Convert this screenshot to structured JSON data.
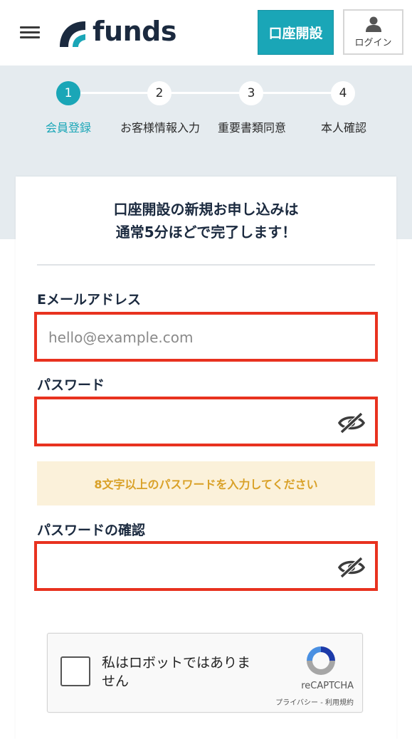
{
  "header": {
    "logo_text": "funds",
    "open_account_label": "口座開設",
    "login_label": "ログイン"
  },
  "steps": [
    {
      "number": "1",
      "label": "会員登録",
      "active": true
    },
    {
      "number": "2",
      "label": "お客様情報入力",
      "active": false
    },
    {
      "number": "3",
      "label": "重要書類同意",
      "active": false
    },
    {
      "number": "4",
      "label": "本人確認",
      "active": false
    }
  ],
  "form": {
    "heading_line1": "口座開設の新規お申し込みは",
    "heading_line2": "通常5分ほどで完了します！",
    "email_label": "Eメールアドレス",
    "email_placeholder": "hello@example.com",
    "email_value": "",
    "password_label": "パスワード",
    "password_value": "",
    "password_hint": "8文字以上のパスワードを入力してください",
    "confirm_label": "パスワードの確認",
    "confirm_value": ""
  },
  "recaptcha": {
    "text": "私はロボットではありません",
    "brand": "reCAPTCHA",
    "links": "プライバシー - 利用規約",
    "checked": false
  },
  "colors": {
    "accent": "#1aa6b7",
    "highlight_border": "#e8321f",
    "hint_bg": "#fbf1da",
    "hint_text": "#d9a128",
    "steps_bg": "#e5ebef"
  },
  "icons": [
    "menu-icon",
    "logo-icon",
    "person-icon",
    "eye-off-icon",
    "recaptcha-logo-icon"
  ]
}
